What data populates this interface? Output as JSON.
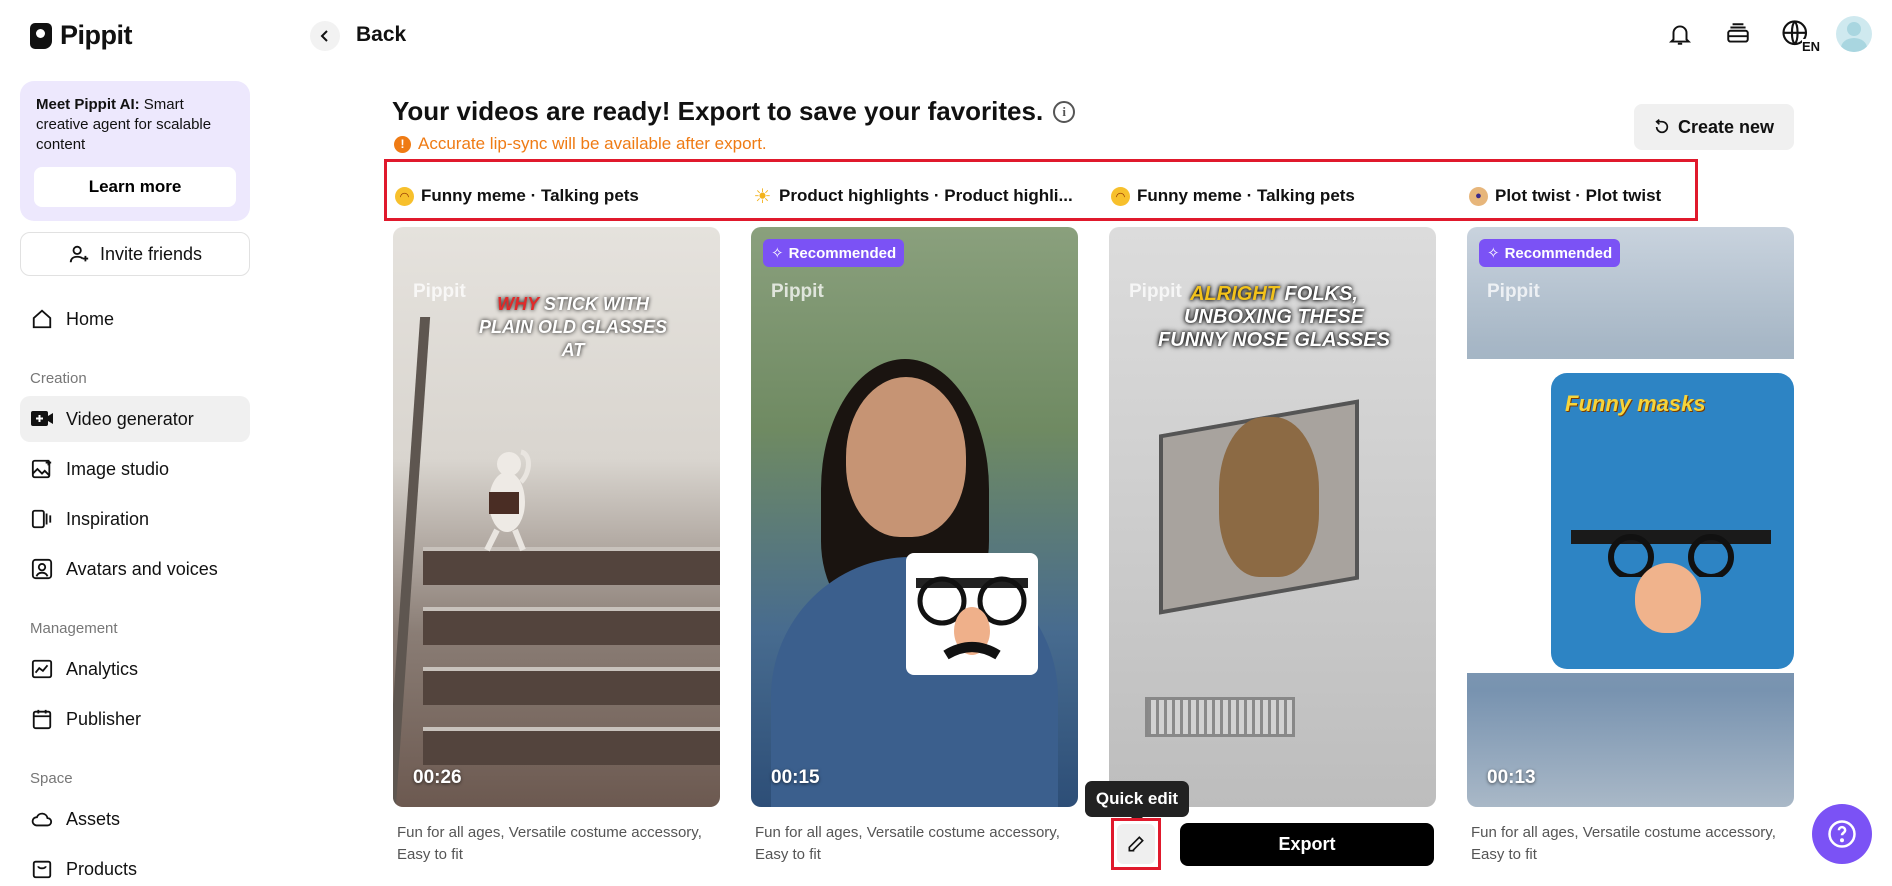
{
  "app": {
    "logo_text": "Pippit"
  },
  "sidebar": {
    "promo": {
      "title": "Meet Pippit AI:",
      "text": " Smart creative agent for scalable content",
      "button": "Learn more"
    },
    "invite_label": "Invite friends",
    "home_label": "Home",
    "sections": {
      "creation": "Creation",
      "management": "Management",
      "space": "Space"
    },
    "creation_items": [
      {
        "label": "Video generator",
        "icon": "video-plus-icon",
        "active": true
      },
      {
        "label": "Image studio",
        "icon": "image-plus-icon"
      },
      {
        "label": "Inspiration",
        "icon": "inspiration-icon"
      },
      {
        "label": "Avatars and voices",
        "icon": "avatar-icon"
      }
    ],
    "management_items": [
      {
        "label": "Analytics",
        "icon": "chart-icon"
      },
      {
        "label": "Publisher",
        "icon": "calendar-icon"
      }
    ],
    "space_items": [
      {
        "label": "Assets",
        "icon": "cloud-icon"
      },
      {
        "label": "Products",
        "icon": "bag-icon"
      }
    ]
  },
  "header": {
    "back_label": "Back",
    "icons": [
      "bell-icon",
      "layers-icon",
      "globe-language-icon",
      "avatar"
    ],
    "language": "EN"
  },
  "main": {
    "title": "Your videos are ready! Export to save your favorites.",
    "notice": "Accurate lip-sync will be available after export.",
    "create_new_label": "Create new",
    "tabs": [
      {
        "emoji": "laughing-emoji",
        "label": "Funny meme · Talking pets"
      },
      {
        "emoji": "sun-emoji",
        "label": "Product highlights · Product highli..."
      },
      {
        "emoji": "laughing-emoji",
        "label": "Funny meme · Talking pets"
      },
      {
        "emoji": "person-shrugging-emoji",
        "label": "Plot twist · Plot twist"
      }
    ],
    "cards": [
      {
        "duration": "00:26",
        "watermark": "Pippit",
        "caption_lead": "WHY",
        "caption": " STICK WITH PLAIN OLD GLASSES AT",
        "description": "Fun for all ages, Versatile costume accessory, Easy to fit"
      },
      {
        "duration": "00:15",
        "watermark": "Pippit",
        "badge": "Recommended",
        "description": "Fun for all ages, Versatile costume accessory, Easy to fit"
      },
      {
        "watermark": "Pippit",
        "caption_lead": "ALRIGHT",
        "caption": " FOLKS, UNBOXING THESE FUNNY NOSE GLASSES",
        "quick_edit_tooltip": "Quick edit",
        "export_label": "Export"
      },
      {
        "duration": "00:13",
        "watermark": "Pippit",
        "badge": "Recommended",
        "package_text": "Funny masks",
        "description": "Fun for all ages, Versatile costume accessory, Easy to fit"
      }
    ]
  },
  "colors": {
    "accent": "#7b52f5",
    "warning": "#ef7b14",
    "highlight_border": "#e0192c",
    "promo_bg": "#ede8fd"
  }
}
